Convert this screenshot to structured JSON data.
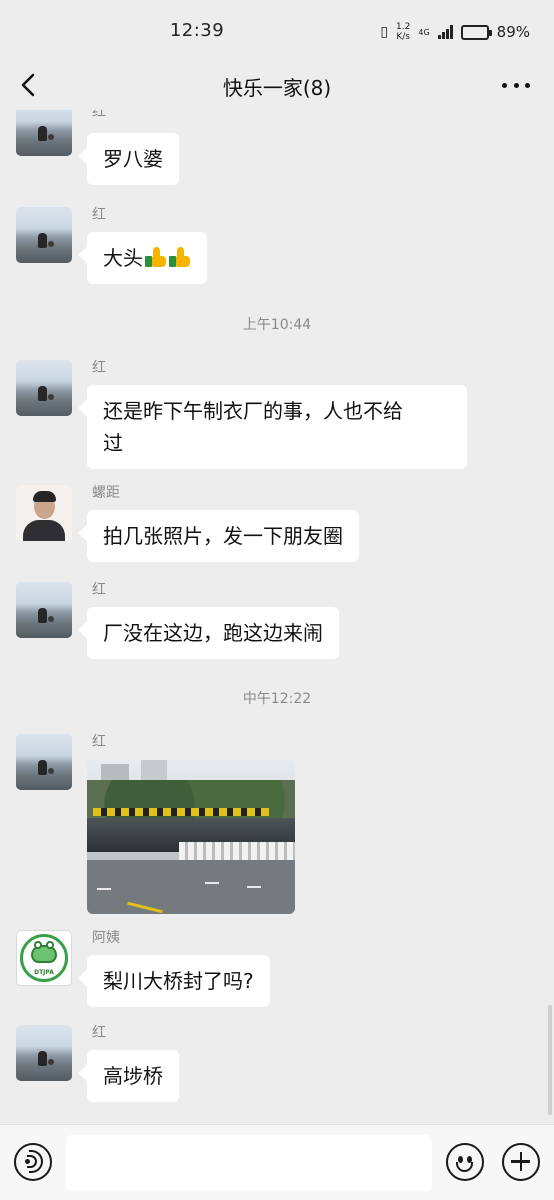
{
  "status_bar": {
    "time": "12:39",
    "net_speed_value": "1.2",
    "net_speed_unit": "K/s",
    "network_type": "4G",
    "battery": "89%",
    "battery_level": 0.89
  },
  "header": {
    "title": "快乐一家(8)"
  },
  "messages": [
    {
      "sender": "红",
      "text": "罗八婆"
    },
    {
      "sender": "红",
      "text": "大头"
    },
    {
      "timestamp": "上午10:44"
    },
    {
      "sender": "红",
      "lines": [
        "还是昨下午制衣厂的事，人也不给",
        "过"
      ]
    },
    {
      "sender": "螺距",
      "text": "拍几张照片，发一下朋友圈"
    },
    {
      "sender": "红",
      "text": "厂没在这边，跑这边来闹"
    },
    {
      "timestamp": "中午12:22"
    },
    {
      "sender": "红",
      "image": "street-photo"
    },
    {
      "sender": "阿姨",
      "text": "梨川大桥封了吗?"
    },
    {
      "sender": "红",
      "text": "高埗桥"
    }
  ],
  "avatar_logo_text": "DTJPA",
  "input": {
    "value": ""
  },
  "icons": [
    "back-icon",
    "more-icon",
    "voice-icon",
    "emoji-icon",
    "plus-icon",
    "thumbs-up-icon"
  ]
}
